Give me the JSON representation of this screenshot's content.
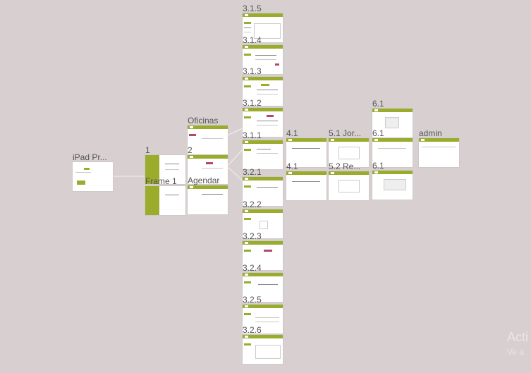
{
  "canvas": {
    "background": "#d8d0d0",
    "accent": "#9aac2c",
    "secondary": "#b5476b"
  },
  "frames": {
    "f_3_1_5": "3.1.5",
    "f_3_1_4": "3.1.4",
    "f_3_1_3": "3.1.3",
    "f_3_1_2": "3.1.2",
    "f_3_1_1": "3.1.1",
    "f_3_2_1": "3.2.1",
    "f_3_2_2": "3.2.2",
    "f_3_2_3": "3.2.3",
    "f_3_2_4": "3.2.4",
    "f_3_2_5": "3.2.5",
    "f_3_2_6": "3.2.6",
    "ipad": "iPad Pr...",
    "one": "1",
    "two": "2",
    "frame1": "Frame 1",
    "oficinas": "Oficinas",
    "agendar": "Agendar",
    "f_4_1_a": "4.1",
    "f_4_1_b": "4.1",
    "f_5_1": "5.1 Jor...",
    "f_5_2": "5.2 Re...",
    "f_6_1_a": "6.1",
    "f_6_1_b": "6.1",
    "f_6_1_c": "6.1",
    "admin": "admin"
  },
  "watermark": {
    "line1": "Acti",
    "line2": "Ve a"
  }
}
